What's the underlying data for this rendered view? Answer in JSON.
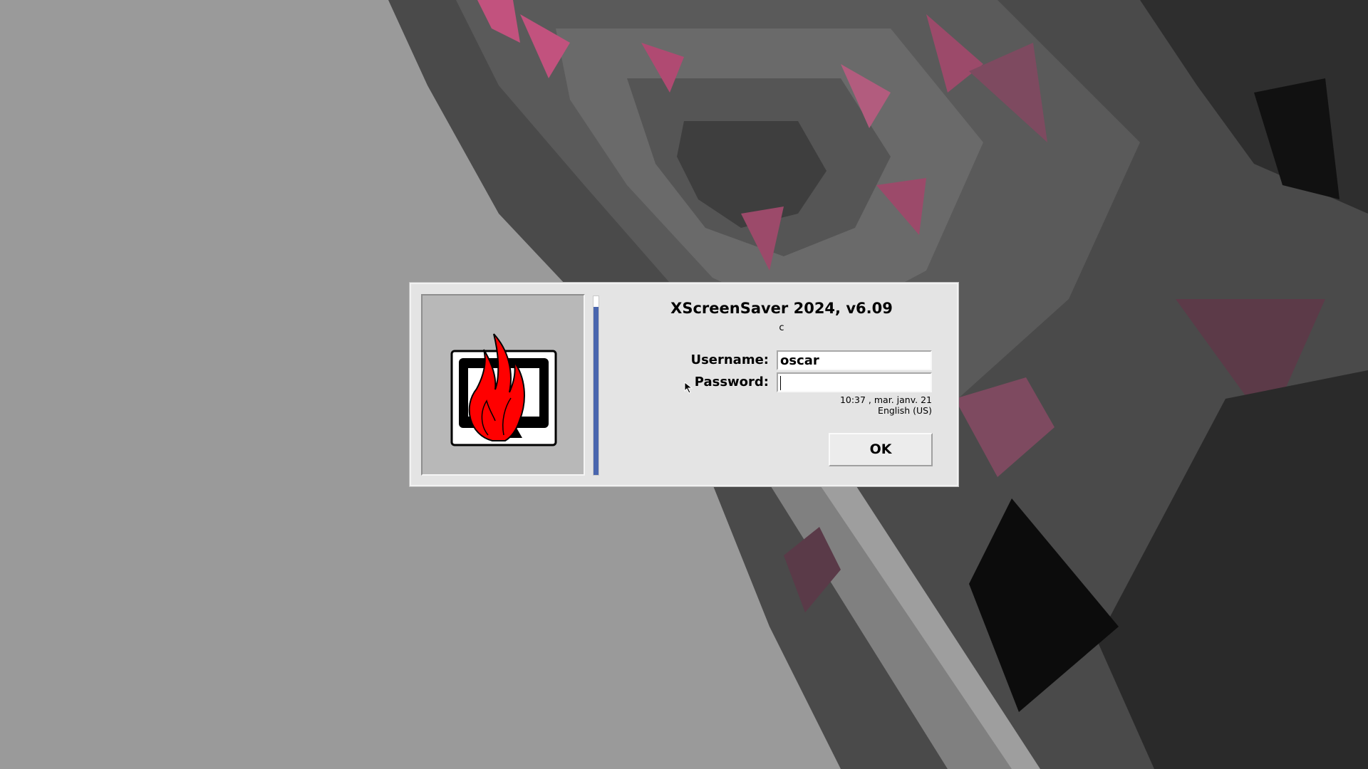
{
  "dialog": {
    "title": "XScreenSaver 2024, v6.09",
    "subtitle": "c",
    "username_label": "Username:",
    "username_value": "oscar",
    "password_label": "Password:",
    "password_value": "",
    "datetime": "10:37 , mar. janv. 21",
    "keyboard_layout": "English (US)",
    "ok_label": "OK",
    "countdown_fraction": 0.94
  },
  "colors": {
    "countdown_fill": "#4a66ae",
    "logo_flame": "#ff0000",
    "backdrop_pink": "#b25c7e"
  },
  "icons": {
    "logo": "xscreensaver-flaming-monitor-logo",
    "pointer": "mouse-pointer-icon"
  }
}
